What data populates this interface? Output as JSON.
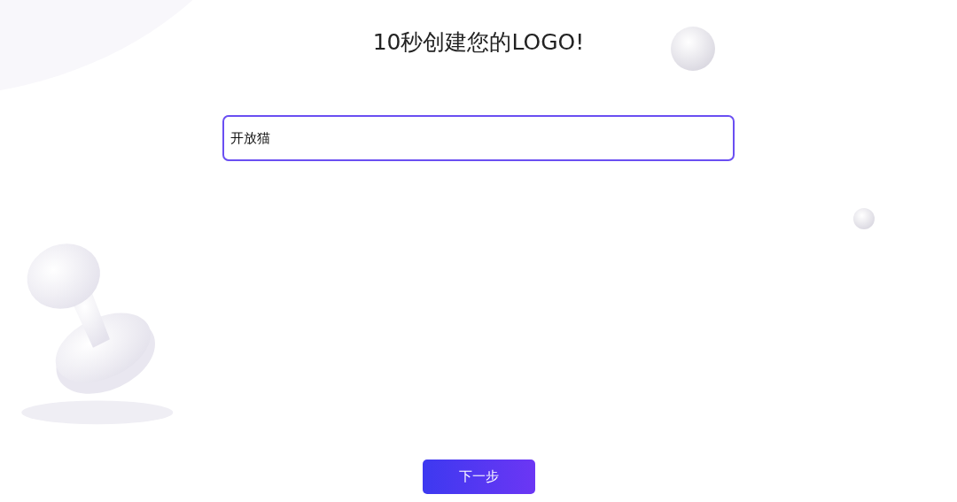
{
  "title": "10秒创建您的LOGO!",
  "name_field": {
    "value": "开放猫"
  },
  "next_button": {
    "label": "下一步"
  }
}
